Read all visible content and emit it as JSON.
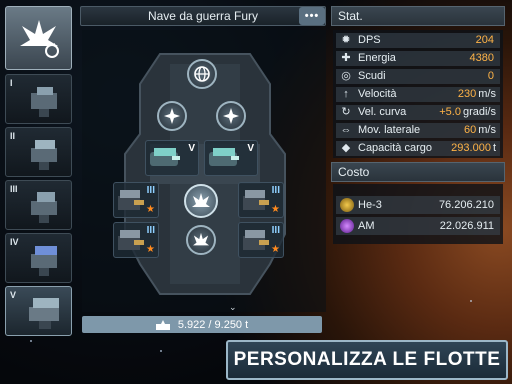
{
  "header": {
    "ship_name": "Nave da guerra Fury",
    "menu_label": "•••"
  },
  "tiers": [
    {
      "label": "I"
    },
    {
      "label": "II"
    },
    {
      "label": "III"
    },
    {
      "label": "IV"
    },
    {
      "label": "V"
    }
  ],
  "modules": {
    "heavy_left": {
      "level": "V"
    },
    "heavy_right": {
      "level": "V"
    },
    "weapons": [
      {
        "level": "III"
      },
      {
        "level": "III"
      },
      {
        "level": "III"
      },
      {
        "level": "III"
      }
    ]
  },
  "weight": {
    "value": "5.922 / 9.250 t"
  },
  "stats": {
    "title": "Stat.",
    "rows": [
      {
        "label": "DPS",
        "value": "204",
        "unit": "",
        "icon": "dps-icon"
      },
      {
        "label": "Energia",
        "value": "4380",
        "unit": "",
        "icon": "health-icon"
      },
      {
        "label": "Scudi",
        "value": "0",
        "unit": "",
        "icon": "shield-icon"
      },
      {
        "label": "Velocità",
        "value": "230",
        "unit": "m/s",
        "icon": "speed-icon"
      },
      {
        "label": "Vel. curva",
        "value": "+5.0",
        "unit": "gradi/s",
        "icon": "turn-icon"
      },
      {
        "label": "Mov. laterale",
        "value": "60",
        "unit": "m/s",
        "icon": "strafe-icon"
      },
      {
        "label": "Capacità cargo",
        "value": "293.000",
        "unit": "t",
        "icon": "cargo-icon"
      }
    ]
  },
  "cost": {
    "title": "Costo",
    "rows": [
      {
        "label": "He-3",
        "value": "76.206.210",
        "icon": "he3-icon"
      },
      {
        "label": "AM",
        "value": "22.026.911",
        "icon": "antimatter-icon"
      }
    ]
  },
  "banner": {
    "text": "PERSONALIZZA LE FLOTTE"
  },
  "colors": {
    "accent_value": "#ffb347",
    "level_blue": "#8fd0ff",
    "level_orange": "#ff8a1e"
  }
}
